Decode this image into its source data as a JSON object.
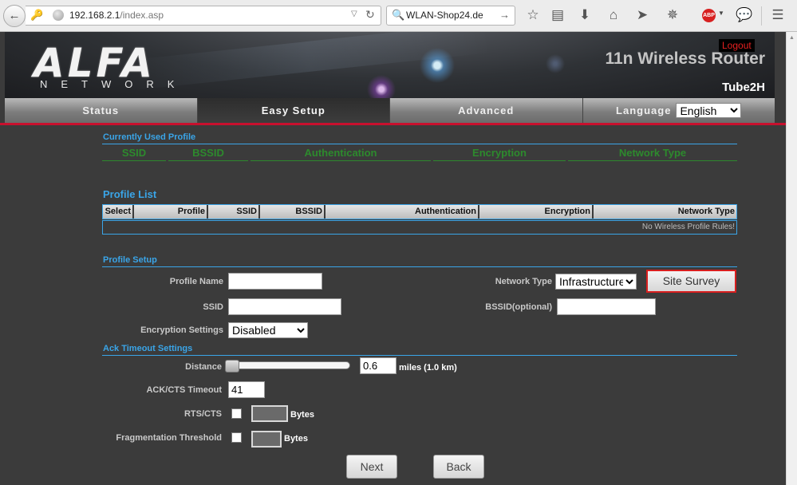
{
  "browser": {
    "url_host": "192.168.2.1",
    "url_path": "/index.asp",
    "search_text": "WLAN-Shop24.de",
    "adblock_label": "ABP"
  },
  "banner": {
    "brand": "ALFA",
    "brand_sub": "NETWORK",
    "logout": "Logout",
    "product_title": "11n Wireless Router",
    "model": "Tube2H"
  },
  "tabs": [
    {
      "label": "Status",
      "active": false
    },
    {
      "label": "Easy Setup",
      "active": true
    },
    {
      "label": "Advanced",
      "active": false
    },
    {
      "label": "Language",
      "active": false
    }
  ],
  "language": {
    "selected": "English"
  },
  "current_profile": {
    "title": "Currently Used Profile",
    "columns": [
      "SSID",
      "BSSID",
      "Authentication",
      "Encryption",
      "Network Type"
    ]
  },
  "profile_list": {
    "title": "Profile List",
    "columns": [
      "Select",
      "Profile",
      "SSID",
      "BSSID",
      "Authentication",
      "Encryption",
      "Network Type"
    ],
    "empty_text": "No Wireless Profile Rules!"
  },
  "profile_setup": {
    "title": "Profile Setup",
    "profile_name_label": "Profile Name",
    "profile_name_value": "",
    "network_type_label": "Network Type",
    "network_type_value": "Infrastructure",
    "site_survey_label": "Site Survey",
    "ssid_label": "SSID",
    "ssid_value": "",
    "bssid_label": "BSSID(optional)",
    "bssid_value": "",
    "encryption_label": "Encryption Settings",
    "encryption_value": "Disabled"
  },
  "ack_timeout": {
    "title": "Ack Timeout Settings",
    "distance_label": "Distance",
    "distance_value": "0.6",
    "distance_unit": "miles (1.0 km)",
    "ack_cts_label": "ACK/CTS Timeout",
    "ack_cts_value": "41",
    "rts_cts_label": "RTS/CTS",
    "rts_cts_unit": "Bytes",
    "frag_label": "Fragmentation Threshold",
    "frag_unit": "Bytes"
  },
  "buttons": {
    "next": "Next",
    "back": "Back"
  }
}
